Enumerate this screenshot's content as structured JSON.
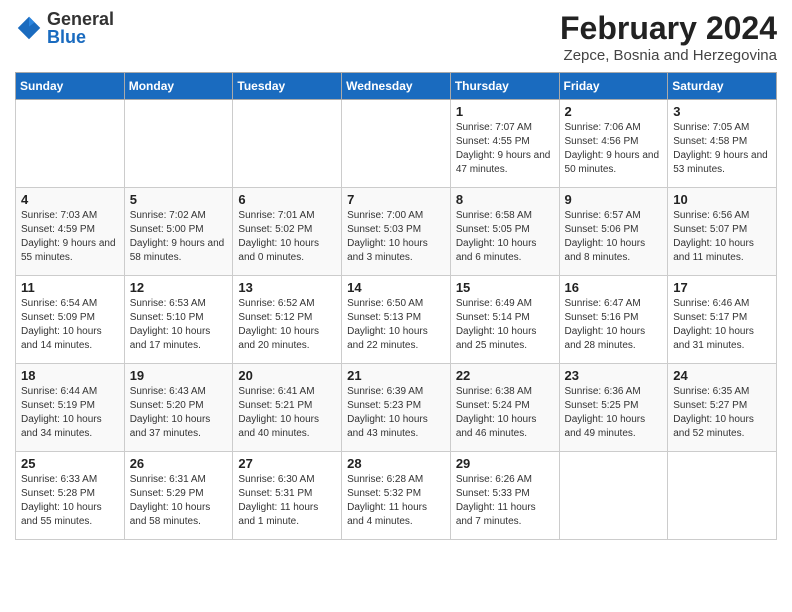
{
  "header": {
    "logo_general": "General",
    "logo_blue": "Blue",
    "title": "February 2024",
    "subtitle": "Zepce, Bosnia and Herzegovina"
  },
  "weekdays": [
    "Sunday",
    "Monday",
    "Tuesday",
    "Wednesday",
    "Thursday",
    "Friday",
    "Saturday"
  ],
  "weeks": [
    [
      {
        "day": "",
        "info": ""
      },
      {
        "day": "",
        "info": ""
      },
      {
        "day": "",
        "info": ""
      },
      {
        "day": "",
        "info": ""
      },
      {
        "day": "1",
        "info": "Sunrise: 7:07 AM\nSunset: 4:55 PM\nDaylight: 9 hours and 47 minutes."
      },
      {
        "day": "2",
        "info": "Sunrise: 7:06 AM\nSunset: 4:56 PM\nDaylight: 9 hours and 50 minutes."
      },
      {
        "day": "3",
        "info": "Sunrise: 7:05 AM\nSunset: 4:58 PM\nDaylight: 9 hours and 53 minutes."
      }
    ],
    [
      {
        "day": "4",
        "info": "Sunrise: 7:03 AM\nSunset: 4:59 PM\nDaylight: 9 hours and 55 minutes."
      },
      {
        "day": "5",
        "info": "Sunrise: 7:02 AM\nSunset: 5:00 PM\nDaylight: 9 hours and 58 minutes."
      },
      {
        "day": "6",
        "info": "Sunrise: 7:01 AM\nSunset: 5:02 PM\nDaylight: 10 hours and 0 minutes."
      },
      {
        "day": "7",
        "info": "Sunrise: 7:00 AM\nSunset: 5:03 PM\nDaylight: 10 hours and 3 minutes."
      },
      {
        "day": "8",
        "info": "Sunrise: 6:58 AM\nSunset: 5:05 PM\nDaylight: 10 hours and 6 minutes."
      },
      {
        "day": "9",
        "info": "Sunrise: 6:57 AM\nSunset: 5:06 PM\nDaylight: 10 hours and 8 minutes."
      },
      {
        "day": "10",
        "info": "Sunrise: 6:56 AM\nSunset: 5:07 PM\nDaylight: 10 hours and 11 minutes."
      }
    ],
    [
      {
        "day": "11",
        "info": "Sunrise: 6:54 AM\nSunset: 5:09 PM\nDaylight: 10 hours and 14 minutes."
      },
      {
        "day": "12",
        "info": "Sunrise: 6:53 AM\nSunset: 5:10 PM\nDaylight: 10 hours and 17 minutes."
      },
      {
        "day": "13",
        "info": "Sunrise: 6:52 AM\nSunset: 5:12 PM\nDaylight: 10 hours and 20 minutes."
      },
      {
        "day": "14",
        "info": "Sunrise: 6:50 AM\nSunset: 5:13 PM\nDaylight: 10 hours and 22 minutes."
      },
      {
        "day": "15",
        "info": "Sunrise: 6:49 AM\nSunset: 5:14 PM\nDaylight: 10 hours and 25 minutes."
      },
      {
        "day": "16",
        "info": "Sunrise: 6:47 AM\nSunset: 5:16 PM\nDaylight: 10 hours and 28 minutes."
      },
      {
        "day": "17",
        "info": "Sunrise: 6:46 AM\nSunset: 5:17 PM\nDaylight: 10 hours and 31 minutes."
      }
    ],
    [
      {
        "day": "18",
        "info": "Sunrise: 6:44 AM\nSunset: 5:19 PM\nDaylight: 10 hours and 34 minutes."
      },
      {
        "day": "19",
        "info": "Sunrise: 6:43 AM\nSunset: 5:20 PM\nDaylight: 10 hours and 37 minutes."
      },
      {
        "day": "20",
        "info": "Sunrise: 6:41 AM\nSunset: 5:21 PM\nDaylight: 10 hours and 40 minutes."
      },
      {
        "day": "21",
        "info": "Sunrise: 6:39 AM\nSunset: 5:23 PM\nDaylight: 10 hours and 43 minutes."
      },
      {
        "day": "22",
        "info": "Sunrise: 6:38 AM\nSunset: 5:24 PM\nDaylight: 10 hours and 46 minutes."
      },
      {
        "day": "23",
        "info": "Sunrise: 6:36 AM\nSunset: 5:25 PM\nDaylight: 10 hours and 49 minutes."
      },
      {
        "day": "24",
        "info": "Sunrise: 6:35 AM\nSunset: 5:27 PM\nDaylight: 10 hours and 52 minutes."
      }
    ],
    [
      {
        "day": "25",
        "info": "Sunrise: 6:33 AM\nSunset: 5:28 PM\nDaylight: 10 hours and 55 minutes."
      },
      {
        "day": "26",
        "info": "Sunrise: 6:31 AM\nSunset: 5:29 PM\nDaylight: 10 hours and 58 minutes."
      },
      {
        "day": "27",
        "info": "Sunrise: 6:30 AM\nSunset: 5:31 PM\nDaylight: 11 hours and 1 minute."
      },
      {
        "day": "28",
        "info": "Sunrise: 6:28 AM\nSunset: 5:32 PM\nDaylight: 11 hours and 4 minutes."
      },
      {
        "day": "29",
        "info": "Sunrise: 6:26 AM\nSunset: 5:33 PM\nDaylight: 11 hours and 7 minutes."
      },
      {
        "day": "",
        "info": ""
      },
      {
        "day": "",
        "info": ""
      }
    ]
  ]
}
